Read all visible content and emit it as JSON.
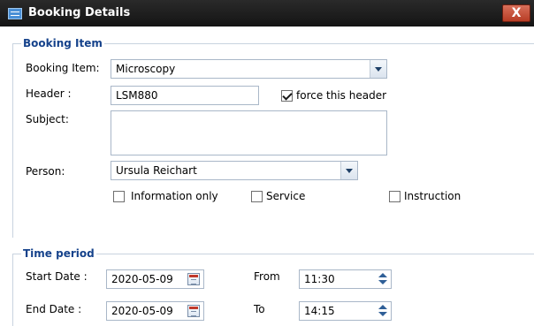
{
  "window": {
    "title": "Booking Details",
    "close_label": "X"
  },
  "booking_section": {
    "legend": "Booking Item",
    "booking_item_label": "Booking Item:",
    "booking_item_value": "Microscopy",
    "header_label": "Header :",
    "header_value": "LSM880",
    "force_header_label": "force this header",
    "force_header_checked": true,
    "subject_label": "Subject:",
    "subject_value": "",
    "person_label": "Person:",
    "person_value": "Ursula Reichart",
    "options": [
      {
        "label": "Information only",
        "checked": false
      },
      {
        "label": "Service",
        "checked": false
      },
      {
        "label": "Instruction",
        "checked": false
      }
    ]
  },
  "time_section": {
    "legend": "Time period",
    "start_date_label": "Start Date :",
    "start_date_value": "2020-05-09",
    "end_date_label": "End Date :",
    "end_date_value": "2020-05-09",
    "from_label": "From",
    "from_value": "11:30",
    "to_label": "To",
    "to_value": "14:15"
  },
  "colors": {
    "legend": "#15428b",
    "titlebar": "#1e1e1e",
    "close": "#c0462e"
  },
  "icons": {
    "app": "window-icon",
    "combo_trigger": "chevron-down-icon",
    "date_trigger": "calendar-icon",
    "spinner": "up-down-arrows-icon"
  }
}
